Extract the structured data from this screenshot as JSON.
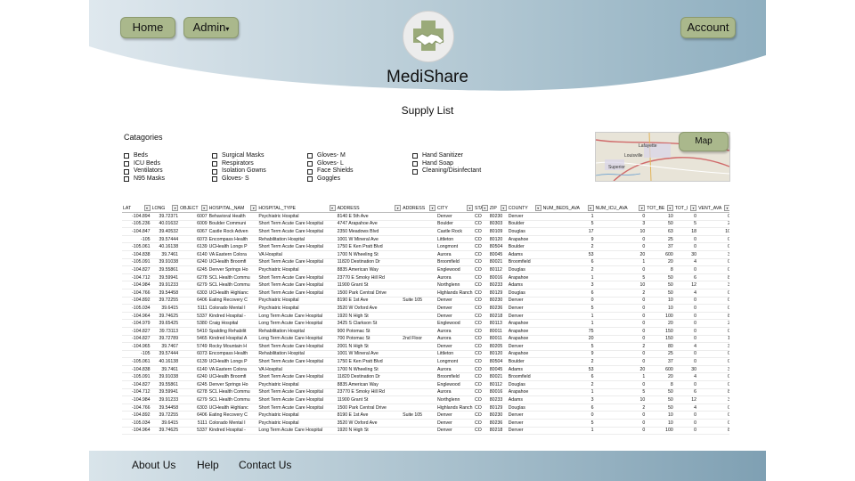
{
  "nav": {
    "home": "Home",
    "admin": "Admin",
    "admin_caret": "▾",
    "account": "Account"
  },
  "brand": {
    "name": "MediShare",
    "logo_icon": "handshake-medical-cross-icon"
  },
  "page": {
    "title": "Supply List"
  },
  "categories": {
    "title": "Catagories",
    "col1": [
      "Beds",
      "ICU Beds",
      "Ventilators",
      "N95 Masks"
    ],
    "col2": [
      "Surgical Masks",
      "Respirators",
      "Isolation Gowns",
      "Gloves- S"
    ],
    "col3": [
      "Gloves- M",
      "Gloves- L",
      "Face Shields",
      "Goggles"
    ],
    "col4": [
      "Hand Sanitizer",
      "Hand Soap",
      "Cleaning/Disinfectant"
    ]
  },
  "map": {
    "button": "Map",
    "labels": [
      "Lafayette",
      "Louisville",
      "Superior"
    ]
  },
  "table": {
    "columns": [
      "LAT",
      "LONG",
      "OBJECT",
      "HOSPITAL_NAM",
      "HOSPITAL_TYPE",
      "ADDRESS",
      "ADDRESS",
      "CITY",
      "STA",
      "ZIP",
      "COUNTY",
      "NUM_BEDS_AVA",
      "NUM_ICU_AVA",
      "TOT_BE",
      "TOT_I",
      "VENT_AVA"
    ],
    "rows": [
      [
        "-104.894",
        "39.72371",
        "6007",
        "Behavioral Health",
        "Psychiatric Hospital",
        "8140 E 5th Ave",
        "",
        "Denver",
        "CO",
        "80230",
        "Denver",
        "1",
        "0",
        "10",
        "0",
        "0"
      ],
      [
        "-105.236",
        "40.01632",
        "6009",
        "Boulder Communi",
        "Short Term Acute Care Hospital",
        "4747 Arapahoe Ave",
        "",
        "Boulder",
        "CO",
        "80303",
        "Boulder",
        "5",
        "3",
        "50",
        "5",
        "2"
      ],
      [
        "-104.847",
        "39.40532",
        "6067",
        "Castle Rock Adven",
        "Short Term Acute Care Hospital",
        "2350 Meadows Blvd",
        "",
        "Castle Rock",
        "CO",
        "80109",
        "Douglas",
        "17",
        "10",
        "63",
        "18",
        "10"
      ],
      [
        "-105",
        "39.57444",
        "6073",
        "Encompass Health",
        "Rehabilitation Hospital",
        "1001 W Mineral Ave",
        "",
        "Littleton",
        "CO",
        "80120",
        "Arapahoe",
        "9",
        "0",
        "25",
        "0",
        "0"
      ],
      [
        "-105.061",
        "40.16138",
        "6139",
        "UCHealth Longs P",
        "Short Term Acute Care Hospital",
        "1750 E Ken Pratt Blvd",
        "",
        "Longmont",
        "CO",
        "80504",
        "Boulder",
        "2",
        "0",
        "37",
        "0",
        "0"
      ],
      [
        "-104.838",
        "39.7461",
        "6140",
        "VA Eastern Colora",
        "VA Hospital",
        "1700 N Wheeling St",
        "",
        "Aurora",
        "CO",
        "80045",
        "Adams",
        "53",
        "20",
        "600",
        "30",
        "3"
      ],
      [
        "-105.091",
        "39.91038",
        "6240",
        "UCHealth Broomfi",
        "Short Term Acute Care Hospital",
        "11820 Destination Dr",
        "",
        "Broomfield",
        "CO",
        "80021",
        "Broomfield",
        "6",
        "1",
        "20",
        "4",
        "0"
      ],
      [
        "-104.827",
        "39.55861",
        "6245",
        "Denver Springs Ho",
        "Psychiatric Hospital",
        "8835 American Way",
        "",
        "Englewood",
        "CO",
        "80112",
        "Douglas",
        "2",
        "0",
        "8",
        "0",
        "0"
      ],
      [
        "-104.712",
        "39.59941",
        "6278",
        "SCL Health Commu",
        "Short Term Acute Care Hospital",
        "23770 E Smoky Hill Rd",
        "",
        "Aurora",
        "CO",
        "80016",
        "Arapahoe",
        "1",
        "5",
        "50",
        "6",
        "8"
      ],
      [
        "-104.984",
        "39.91233",
        "6279",
        "SCL Health Commu",
        "Short Term Acute Care Hospital",
        "11900 Grant St",
        "",
        "Northglenn",
        "CO",
        "80233",
        "Adams",
        "3",
        "10",
        "50",
        "12",
        "3"
      ],
      [
        "-104.766",
        "39.54458",
        "6303",
        "UCHealth Highlanc",
        "Short Term Acute Care Hospital",
        "1500 Park Central Drive",
        "",
        "Highlands Ranch",
        "CO",
        "80129",
        "Douglas",
        "6",
        "2",
        "50",
        "4",
        "0"
      ],
      [
        "-104.892",
        "39.72255",
        "6406",
        "Eating Recovery C",
        "Psychiatric Hospital",
        "8190 E 1st Ave",
        "Suite 105",
        "Denver",
        "CO",
        "80230",
        "Denver",
        "0",
        "0",
        "10",
        "0",
        "0"
      ],
      [
        "-105.034",
        "39.6415",
        "5111",
        "Colorado Mental I",
        "Psychiatric Hospital",
        "3520 W Oxford Ave",
        "",
        "Denver",
        "CO",
        "80236",
        "Denver",
        "5",
        "0",
        "10",
        "0",
        "0"
      ],
      [
        "-104.964",
        "39.74625",
        "5337",
        "Kindred Hospital -",
        "Long Term Acute Care Hospital",
        "1920 N High St",
        "",
        "Denver",
        "CO",
        "80218",
        "Denver",
        "1",
        "0",
        "100",
        "0",
        "8"
      ],
      [
        "-104.979",
        "39.65425",
        "5380",
        "Craig Hospital",
        "Long Term Acute Care Hospital",
        "3425 S Clarkson St",
        "",
        "Englewood",
        "CO",
        "80113",
        "Arapahoe",
        "1",
        "0",
        "20",
        "0",
        "2"
      ],
      [
        "-104.827",
        "39.73113",
        "5410",
        "Spalding Rehabilit",
        "Rehabilitation Hospital",
        "900 Potomac St",
        "",
        "Aurora",
        "CO",
        "80011",
        "Arapahoe",
        "75",
        "0",
        "150",
        "0",
        "0"
      ],
      [
        "-104.827",
        "39.72789",
        "5465",
        "Kindred Hospital A",
        "Long Term Acute Care Hospital",
        "700 Potomac St",
        "2nd Floor",
        "Aurora",
        "CO",
        "80011",
        "Arapahoe",
        "20",
        "0",
        "150",
        "0",
        "1"
      ],
      [
        "-104.965",
        "39.7467",
        "5749",
        "Rocky Mountain H",
        "Short Term Acute Care Hospital",
        "2001 N High St",
        "",
        "Denver",
        "CO",
        "80205",
        "Denver",
        "5",
        "2",
        "80",
        "4",
        "3"
      ],
      [
        "-105",
        "39.57444",
        "6073",
        "Encompass Health",
        "Rehabilitation Hospital",
        "1001 W Mineral Ave",
        "",
        "Littleton",
        "CO",
        "80120",
        "Arapahoe",
        "9",
        "0",
        "25",
        "0",
        "0"
      ],
      [
        "-105.061",
        "40.16138",
        "6139",
        "UCHealth Longs P",
        "Short Term Acute Care Hospital",
        "1750 E Ken Pratt Blvd",
        "",
        "Longmont",
        "CO",
        "80504",
        "Boulder",
        "2",
        "0",
        "37",
        "0",
        "0"
      ],
      [
        "-104.838",
        "39.7461",
        "6140",
        "VA Eastern Colora",
        "VA Hospital",
        "1700 N Wheeling St",
        "",
        "Aurora",
        "CO",
        "80045",
        "Adams",
        "53",
        "20",
        "600",
        "30",
        "3"
      ],
      [
        "-105.091",
        "39.91038",
        "6240",
        "UCHealth Broomfi",
        "Short Term Acute Care Hospital",
        "11820 Destination Dr",
        "",
        "Broomfield",
        "CO",
        "80021",
        "Broomfield",
        "6",
        "1",
        "20",
        "4",
        "0"
      ],
      [
        "-104.827",
        "39.55861",
        "6245",
        "Denver Springs Ho",
        "Psychiatric Hospital",
        "8835 American Way",
        "",
        "Englewood",
        "CO",
        "80112",
        "Douglas",
        "2",
        "0",
        "8",
        "0",
        "0"
      ],
      [
        "-104.712",
        "39.59941",
        "6278",
        "SCL Health Commu",
        "Short Term Acute Care Hospital",
        "23770 E Smoky Hill Rd",
        "",
        "Aurora",
        "CO",
        "80016",
        "Arapahoe",
        "1",
        "5",
        "50",
        "6",
        "8"
      ],
      [
        "-104.984",
        "39.91233",
        "6279",
        "SCL Health Commu",
        "Short Term Acute Care Hospital",
        "11900 Grant St",
        "",
        "Northglenn",
        "CO",
        "80233",
        "Adams",
        "3",
        "10",
        "50",
        "12",
        "3"
      ],
      [
        "-104.766",
        "39.54458",
        "6303",
        "UCHealth Highlanc",
        "Short Term Acute Care Hospital",
        "1500 Park Central Drive",
        "",
        "Highlands Ranch",
        "CO",
        "80129",
        "Douglas",
        "6",
        "2",
        "50",
        "4",
        "0"
      ],
      [
        "-104.892",
        "39.72255",
        "6406",
        "Eating Recovery C",
        "Psychiatric Hospital",
        "8190 E 1st Ave",
        "Suite 105",
        "Denver",
        "CO",
        "80230",
        "Denver",
        "0",
        "0",
        "10",
        "0",
        "0"
      ],
      [
        "-105.034",
        "39.6415",
        "5111",
        "Colorado Mental I",
        "Psychiatric Hospital",
        "3520 W Oxford Ave",
        "",
        "Denver",
        "CO",
        "80236",
        "Denver",
        "5",
        "0",
        "10",
        "0",
        "0"
      ],
      [
        "-104.964",
        "39.74625",
        "5337",
        "Kindred Hospital -",
        "Long Term Acute Care Hospital",
        "1920 N High St",
        "",
        "Denver",
        "CO",
        "80218",
        "Denver",
        "1",
        "0",
        "100",
        "0",
        "8"
      ]
    ]
  },
  "footer": {
    "about": "About Us",
    "help": "Help",
    "contact": "Contact Us"
  },
  "colors": {
    "button": "#aab88c",
    "header_gradient_start": "#dfe8ee",
    "header_gradient_end": "#8fafc0",
    "footer_gradient_end": "#7fa0b3"
  }
}
